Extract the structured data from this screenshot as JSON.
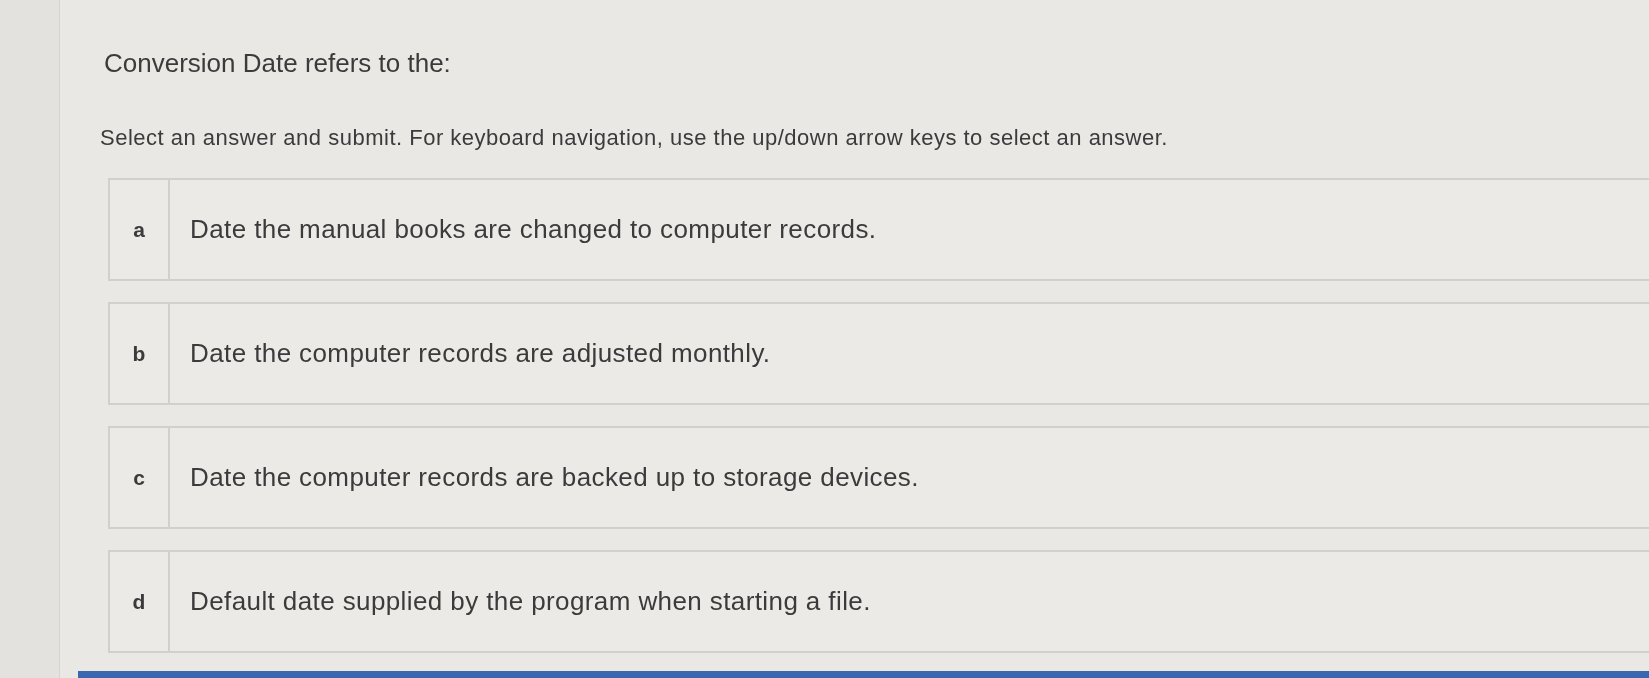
{
  "question": "Conversion Date refers to the:",
  "instructions": "Select an answer and submit. For keyboard navigation, use the up/down arrow keys to select an answer.",
  "options": [
    {
      "letter": "a",
      "text": "Date the manual books are changed to computer records.",
      "selected": false
    },
    {
      "letter": "b",
      "text": "Date the computer records are adjusted monthly.",
      "selected": false
    },
    {
      "letter": "c",
      "text": "Date the computer records are backed up to storage devices.",
      "selected": false
    },
    {
      "letter": "d",
      "text": "Default date supplied by the program when starting a file.",
      "selected": false
    }
  ]
}
